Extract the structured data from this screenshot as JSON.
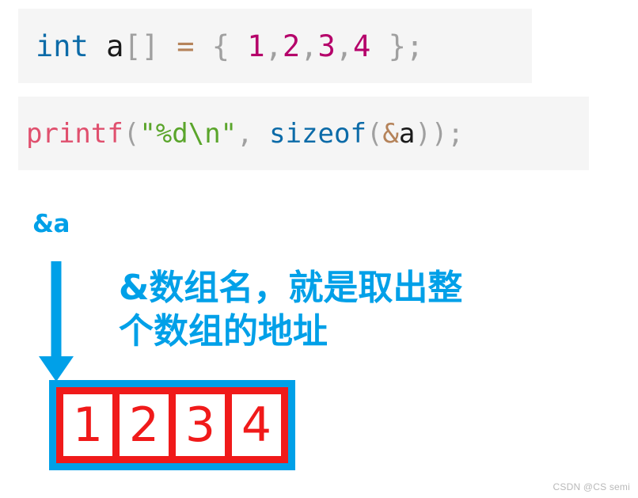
{
  "palette": {
    "code_bg": "#f5f5f5",
    "keyword_blue": "#0c6ba8",
    "plain_black": "#1a1a1a",
    "punct_gray": "#a0a0a0",
    "operator_tan": "#b5835a",
    "number_magenta": "#b5006a",
    "function_pink": "#e0506e",
    "string_green": "#5aa52b",
    "accent_cyan": "#00a0e8",
    "array_red": "#f01a1a",
    "watermark_gray": "#b9b9b9",
    "page_bg": "#ffffff"
  },
  "code_block_1": {
    "name": "array-declaration",
    "tokens": [
      {
        "text": "int",
        "color": "keyword_blue"
      },
      {
        "text": " ",
        "color": "plain_black"
      },
      {
        "text": "a",
        "color": "plain_black"
      },
      {
        "text": "[]",
        "color": "punct_gray"
      },
      {
        "text": " ",
        "color": "plain_black"
      },
      {
        "text": "=",
        "color": "operator_tan"
      },
      {
        "text": " ",
        "color": "plain_black"
      },
      {
        "text": "{",
        "color": "punct_gray"
      },
      {
        "text": " ",
        "color": "plain_black"
      },
      {
        "text": "1",
        "color": "number_magenta"
      },
      {
        "text": ",",
        "color": "punct_gray"
      },
      {
        "text": "2",
        "color": "number_magenta"
      },
      {
        "text": ",",
        "color": "punct_gray"
      },
      {
        "text": "3",
        "color": "number_magenta"
      },
      {
        "text": ",",
        "color": "punct_gray"
      },
      {
        "text": "4",
        "color": "number_magenta"
      },
      {
        "text": " ",
        "color": "plain_black"
      },
      {
        "text": "};",
        "color": "punct_gray"
      }
    ],
    "plain_text": "int a[] = { 1,2,3,4 };"
  },
  "code_block_2": {
    "name": "printf-sizeof-statement",
    "tokens": [
      {
        "text": "printf",
        "color": "function_pink"
      },
      {
        "text": "(",
        "color": "punct_gray"
      },
      {
        "text": "\"%d\\n\"",
        "color": "string_green"
      },
      {
        "text": ",",
        "color": "punct_gray"
      },
      {
        "text": " ",
        "color": "plain_black"
      },
      {
        "text": "sizeof",
        "color": "keyword_blue"
      },
      {
        "text": "(",
        "color": "punct_gray"
      },
      {
        "text": "&",
        "color": "operator_tan"
      },
      {
        "text": "a",
        "color": "plain_black"
      },
      {
        "text": "))",
        "color": "punct_gray"
      },
      {
        "text": ";",
        "color": "punct_gray"
      }
    ],
    "plain_text": "printf(\"%d\\n\", sizeof(&a));"
  },
  "annotation": {
    "pointer_label": "&a",
    "note_line_1": "&数组名，就是取出整",
    "note_line_2": "个数组的地址",
    "note_full": "&数组名，就是取出整个数组的地址",
    "arrow_direction": "down"
  },
  "array_diagram": {
    "name": "array-memory-boxes",
    "cells": [
      "1",
      "2",
      "3",
      "4"
    ],
    "outer_border_color": "#00a0e8",
    "cell_border_color": "#f01a1a",
    "cell_text_color": "#f01a1a"
  },
  "watermark": {
    "text": "CSDN @CS semi"
  }
}
